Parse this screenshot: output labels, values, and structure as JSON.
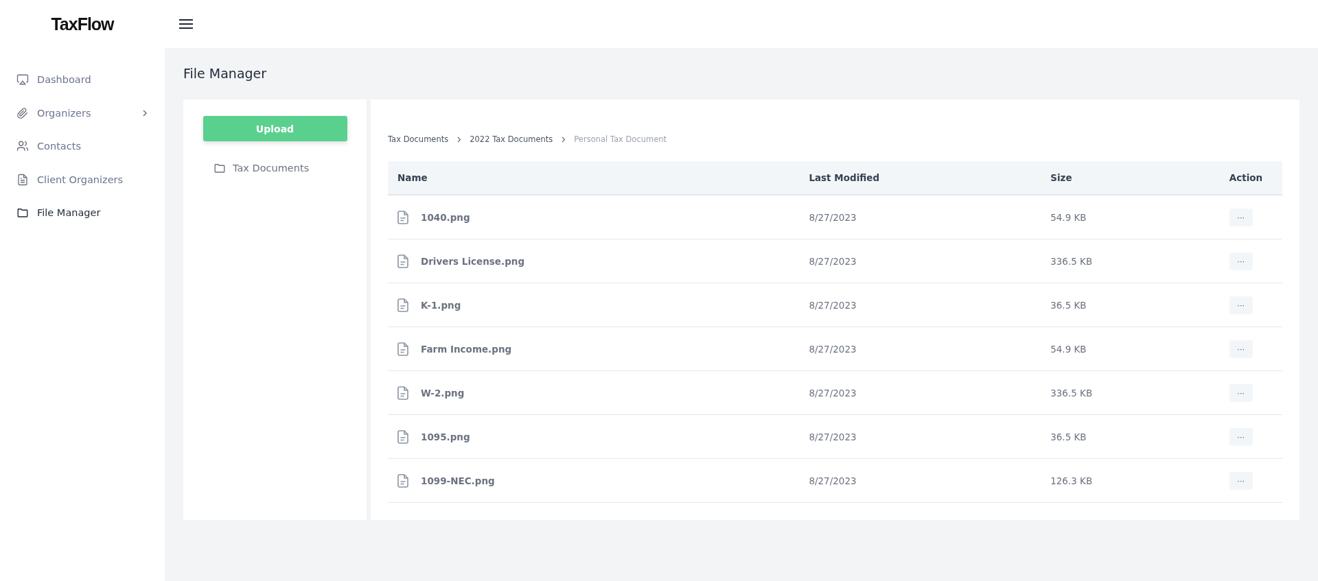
{
  "header": {
    "logo": "TaxFlow"
  },
  "sidebar": {
    "items": [
      {
        "label": "Dashboard",
        "selected": false
      },
      {
        "label": "Organizers",
        "selected": false,
        "expanded": false
      },
      {
        "label": "Contacts",
        "selected": false
      },
      {
        "label": "Client Organizers",
        "selected": false
      },
      {
        "label": "File Manager",
        "selected": true
      }
    ]
  },
  "page": {
    "title": "File Manager"
  },
  "folder_pane": {
    "upload_button": "Upload",
    "folders": [
      {
        "label": "Tax Documents"
      }
    ]
  },
  "breadcrumb": [
    {
      "label": "Tax Documents",
      "current": false
    },
    {
      "label": "2022 Tax Documents",
      "current": false
    },
    {
      "label": "Personal Tax Document",
      "current": true
    }
  ],
  "table": {
    "columns": [
      "Name",
      "Last Modified",
      "Size",
      "Action"
    ],
    "rows": [
      {
        "name": "1040.png",
        "modified": "8/27/2023",
        "size": "54.9 KB",
        "action": "···"
      },
      {
        "name": "Drivers License.png",
        "modified": "8/27/2023",
        "size": "336.5 KB",
        "action": "···"
      },
      {
        "name": "K-1.png",
        "modified": "8/27/2023",
        "size": "36.5 KB",
        "action": "···"
      },
      {
        "name": "Farm Income.png",
        "modified": "8/27/2023",
        "size": "54.9 KB",
        "action": "···"
      },
      {
        "name": "W-2.png",
        "modified": "8/27/2023",
        "size": "336.5 KB",
        "action": "···"
      },
      {
        "name": "1095.png",
        "modified": "8/27/2023",
        "size": "36.5 KB",
        "action": "···"
      },
      {
        "name": "1099-NEC.png",
        "modified": "8/27/2023",
        "size": "126.3 KB",
        "action": "···"
      }
    ]
  }
}
